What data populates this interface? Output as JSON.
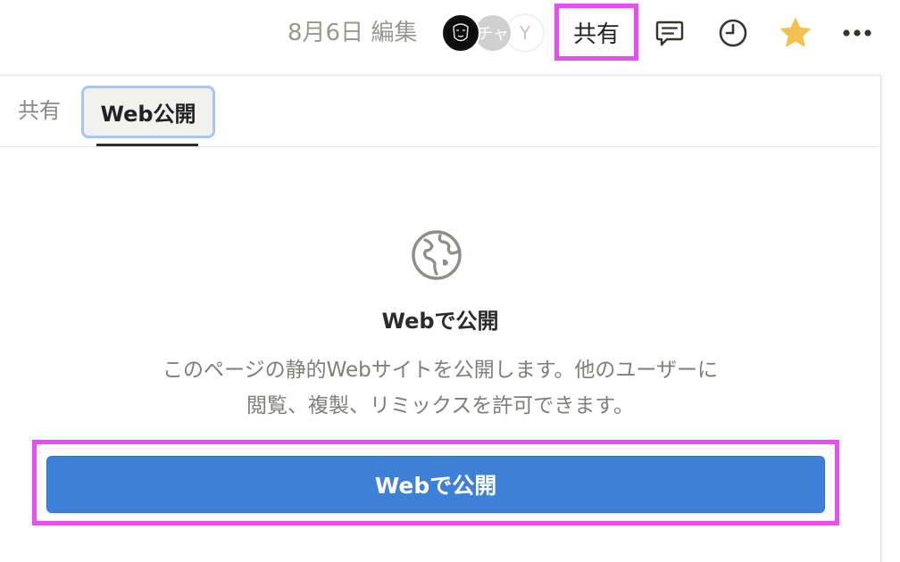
{
  "topbar": {
    "edited_label": "8月6日 編集",
    "avatars": [
      {
        "initial": ""
      },
      {
        "initial": "チャ"
      },
      {
        "initial": "Y"
      }
    ],
    "share_label": "共有",
    "icons": [
      "comment-icon",
      "history-clock-icon",
      "favorite-star-icon",
      "more-icon"
    ]
  },
  "panel": {
    "tabs": [
      {
        "label": "共有"
      },
      {
        "label": "Web公開"
      }
    ],
    "heading": "Webで公開",
    "description_line1": "このページの静的Webサイトを公開します。他のユーザーに",
    "description_line2": "閲覧、複製、リミックスを許可できます。",
    "publish_button_label": "Webで公開"
  },
  "colors": {
    "accent_blue": "#3d80d8",
    "highlight_magenta": "#e94ef2",
    "star_yellow": "#f2c14e",
    "muted_text": "#807e79"
  }
}
